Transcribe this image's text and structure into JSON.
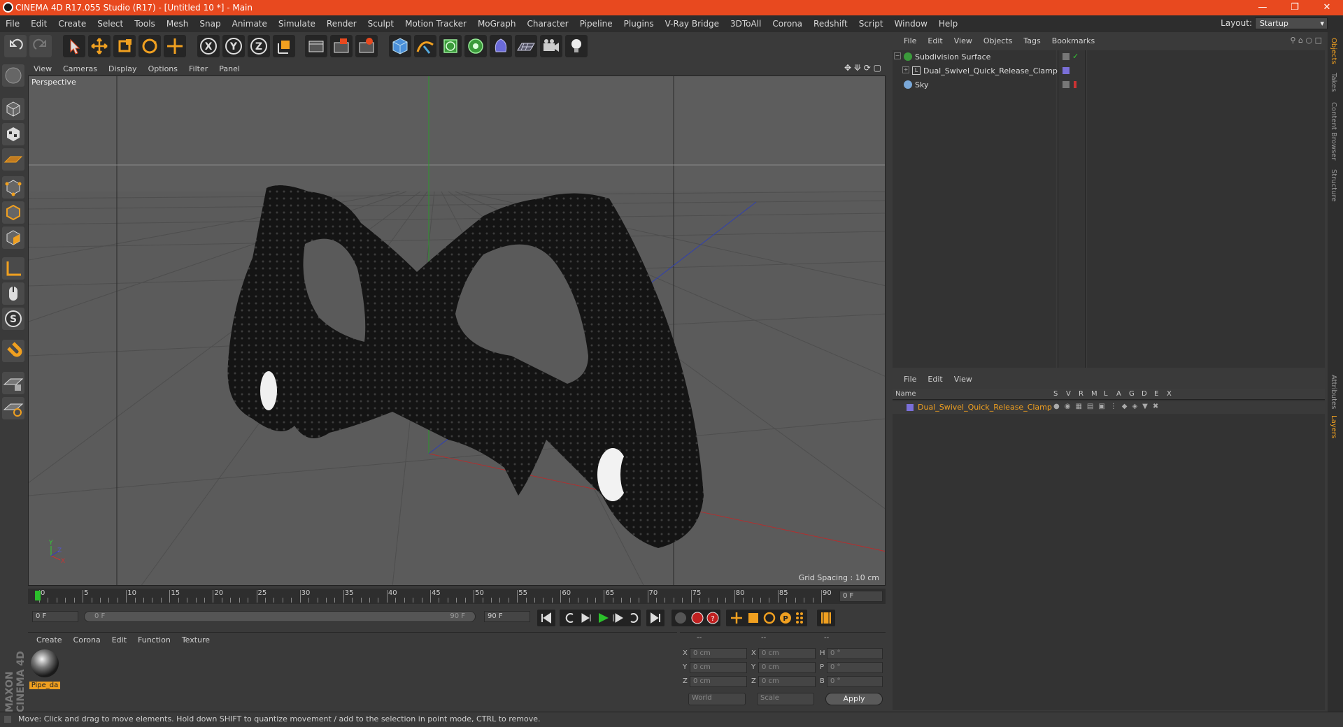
{
  "app": {
    "title": "CINEMA 4D R17.055 Studio (R17) - [Untitled 10 *] - Main",
    "layout_label": "Layout:",
    "layout_value": "Startup",
    "accent_color": "#e8491f"
  },
  "menu": [
    "File",
    "Edit",
    "Create",
    "Select",
    "Tools",
    "Mesh",
    "Snap",
    "Animate",
    "Simulate",
    "Render",
    "Sculpt",
    "Motion Tracker",
    "MoGraph",
    "Character",
    "Pipeline",
    "Plugins",
    "V-Ray Bridge",
    "3DToAll",
    "Corona",
    "Redshift",
    "Script",
    "Window",
    "Help"
  ],
  "viewport": {
    "menu": [
      "View",
      "Cameras",
      "Display",
      "Options",
      "Filter",
      "Panel"
    ],
    "label": "Perspective",
    "grid_spacing": "Grid Spacing : 10 cm"
  },
  "timeline": {
    "ticks": [
      "0",
      "5",
      "10",
      "15",
      "20",
      "25",
      "30",
      "35",
      "40",
      "45",
      "50",
      "55",
      "60",
      "65",
      "70",
      "75",
      "80",
      "85",
      "90"
    ],
    "current_frame": "0 F",
    "start_field": "0 F",
    "range_start": "0 F",
    "range_end": "90 F",
    "end_field": "90 F"
  },
  "materials": {
    "menu": [
      "Create",
      "Corona",
      "Edit",
      "Function",
      "Texture"
    ],
    "items": [
      {
        "name": "Pipe_da"
      }
    ]
  },
  "coords": {
    "headers": [
      "--",
      "--",
      "--"
    ],
    "rows": [
      {
        "a": "X",
        "av": "0 cm",
        "b": "X",
        "bv": "0 cm",
        "c": "H",
        "cv": "0 °"
      },
      {
        "a": "Y",
        "av": "0 cm",
        "b": "Y",
        "bv": "0 cm",
        "c": "P",
        "cv": "0 °"
      },
      {
        "a": "Z",
        "av": "0 cm",
        "b": "Z",
        "bv": "0 cm",
        "c": "B",
        "cv": "0 °"
      }
    ],
    "world": "World",
    "scale": "Scale",
    "apply": "Apply"
  },
  "objects": {
    "menu": [
      "File",
      "Edit",
      "View",
      "Objects",
      "Tags",
      "Bookmarks"
    ],
    "items": [
      "Subdivision Surface",
      "Dual_Swivel_Quick_Release_Clamp",
      "Sky"
    ]
  },
  "layers": {
    "menu": [
      "File",
      "Edit",
      "View"
    ],
    "name_header": "Name",
    "flags": [
      "S",
      "V",
      "R",
      "M",
      "L",
      "A",
      "G",
      "D",
      "E",
      "X"
    ],
    "items": [
      "Dual_Swivel_Quick_Release_Clamp"
    ],
    "layer_color": "#7a6fd8"
  },
  "right_tabs": [
    "Objects",
    "Takes",
    "Content Browser",
    "Structure",
    "Attributes",
    "Layers"
  ],
  "brand": "MAXON CINEMA 4D",
  "status": "Move: Click and drag to move elements. Hold down SHIFT to quantize movement / add to the selection in point mode, CTRL to remove."
}
